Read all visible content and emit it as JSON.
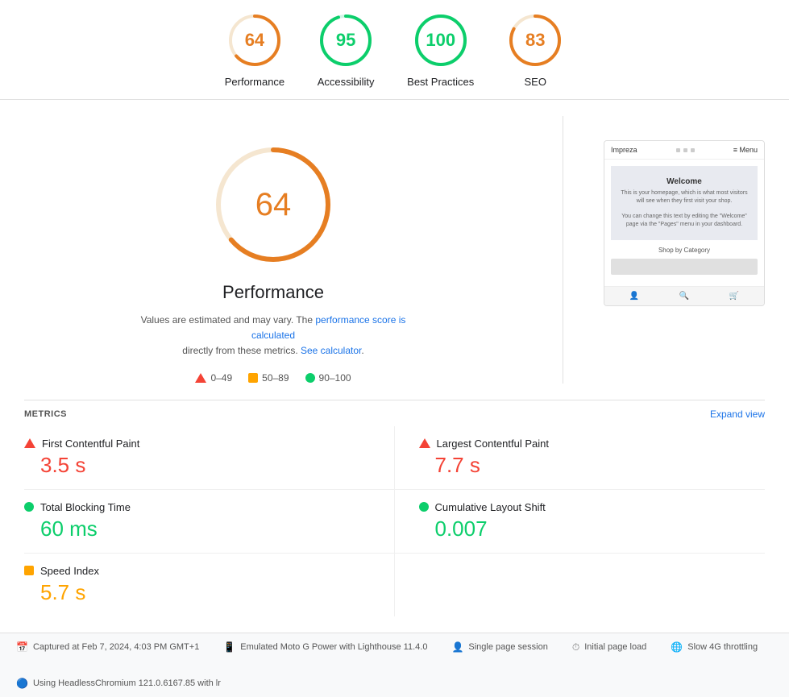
{
  "scores": [
    {
      "id": "performance",
      "value": 64,
      "label": "Performance",
      "color": "#e67e22",
      "bg": "#fff3e0",
      "ring_color": "#e67e22",
      "circumference": 188,
      "dashoffset": 68
    },
    {
      "id": "accessibility",
      "value": 95,
      "label": "Accessibility",
      "color": "#0cce6b",
      "ring_color": "#0cce6b",
      "circumference": 188,
      "dashoffset": 9
    },
    {
      "id": "best-practices",
      "value": 100,
      "label": "Best Practices",
      "color": "#0cce6b",
      "ring_color": "#0cce6b",
      "circumference": 188,
      "dashoffset": 0
    },
    {
      "id": "seo",
      "value": 83,
      "label": "SEO",
      "color": "#e67e22",
      "ring_color": "#e67e22",
      "circumference": 188,
      "dashoffset": 32
    }
  ],
  "big_gauge": {
    "value": 64,
    "color": "#e67e22"
  },
  "perf": {
    "title": "Performance",
    "desc_part1": "Values are estimated and may vary. The ",
    "desc_link1": "performance score is calculated",
    "desc_part2": "directly from these metrics. ",
    "desc_link2": "See calculator",
    "desc_end": "."
  },
  "legend": {
    "red_range": "0–49",
    "orange_range": "50–89",
    "green_range": "90–100"
  },
  "webpage": {
    "site_name": "Impreza",
    "nav_label": "≡ Menu",
    "hero_title": "Welcome",
    "hero_text": "This is your homepage, which is what most visitors will see when they first visit your shop.\n\nYou can change this text by editing the \"Welcome\" page via the \"Pages\" menu in your dashboard.",
    "section_title": "Shop by Category"
  },
  "metrics": {
    "header": "METRICS",
    "expand_label": "Expand view",
    "items": [
      {
        "id": "fcp",
        "name": "First Contentful Paint",
        "value": "3.5 s",
        "status": "red"
      },
      {
        "id": "lcp",
        "name": "Largest Contentful Paint",
        "value": "7.7 s",
        "status": "red"
      },
      {
        "id": "tbt",
        "name": "Total Blocking Time",
        "value": "60 ms",
        "status": "green"
      },
      {
        "id": "cls",
        "name": "Cumulative Layout Shift",
        "value": "0.007",
        "status": "green"
      },
      {
        "id": "si",
        "name": "Speed Index",
        "value": "5.7 s",
        "status": "orange"
      }
    ]
  },
  "footer": {
    "items": [
      {
        "icon": "📅",
        "text": "Captured at Feb 7, 2024, 4:03 PM GMT+1"
      },
      {
        "icon": "📱",
        "text": "Emulated Moto G Power with Lighthouse 11.4.0"
      },
      {
        "icon": "👤",
        "text": "Single page session"
      },
      {
        "icon": "⏱",
        "text": "Initial page load"
      },
      {
        "icon": "🌐",
        "text": "Slow 4G throttling"
      },
      {
        "icon": "🔵",
        "text": "Using HeadlessChromium 121.0.6167.85 with lr"
      }
    ]
  }
}
